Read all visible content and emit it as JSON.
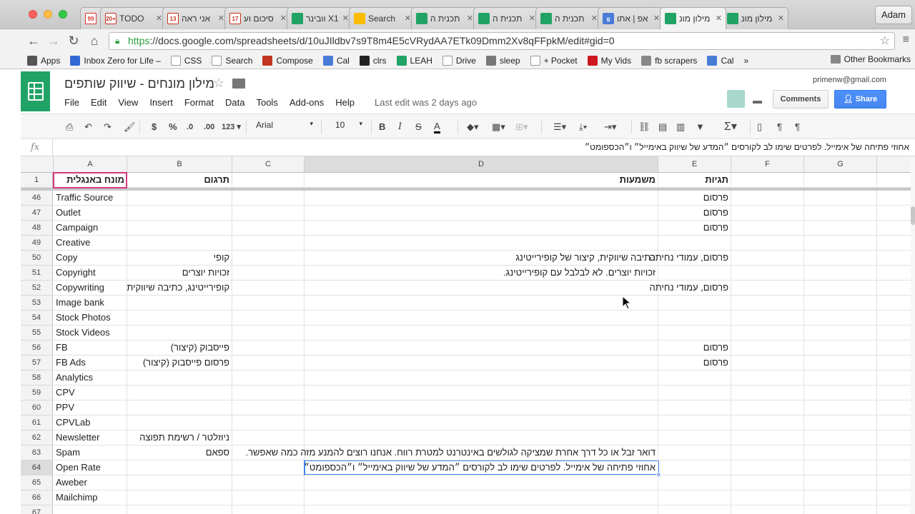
{
  "browser": {
    "tabs": [
      {
        "label": "",
        "fav": "num",
        "fav_text": "99",
        "active": false,
        "width": 34
      },
      {
        "label": "TODO",
        "fav": "gmail",
        "fav_text": "20+",
        "active": false
      },
      {
        "label": "אני ראה",
        "fav": "gmail",
        "fav_text": "13",
        "active": false
      },
      {
        "label": "סיכום וע",
        "fav": "gmail",
        "fav_text": "17",
        "active": false
      },
      {
        "label": "וובינר X1",
        "fav": "sheet",
        "fav_text": "",
        "active": false
      },
      {
        "label": "Search",
        "fav": "drive",
        "fav_text": "",
        "active": false
      },
      {
        "label": "תכנית ה",
        "fav": "sheet",
        "fav_text": "",
        "active": false
      },
      {
        "label": "תכנית ה",
        "fav": "sheet",
        "fav_text": "",
        "active": false
      },
      {
        "label": "תכנית ה",
        "fav": "sheet",
        "fav_text": "",
        "active": false
      },
      {
        "label": "אפ | אתו",
        "fav": "g",
        "fav_text": "g",
        "active": false
      },
      {
        "label": "מילון מונ",
        "fav": "sheet",
        "fav_text": "",
        "active": true
      },
      {
        "label": "מילון מונ",
        "fav": "sheet",
        "fav_text": "",
        "active": false
      }
    ],
    "profile_name": "Adam",
    "url_scheme": "https",
    "url_rest": "://docs.google.com/spreadsheets/d/10uJIldbv7s9T8m4E5cVRydAA7ETk09Dmm2Xv8qFFpkM/edit#gid=0",
    "bookmarks": [
      {
        "label": "Apps",
        "icon": "apps-icon",
        "color": "#555"
      },
      {
        "label": "Inbox Zero for Life –",
        "icon": "bookmark-icon",
        "color": "#3367d6"
      },
      {
        "label": "CSS",
        "icon": "page-icon",
        "color": "#fff"
      },
      {
        "label": "Search",
        "icon": "cursor-icon",
        "color": "#fff"
      },
      {
        "label": "Compose",
        "icon": "gmail-icon",
        "color": "#c23321"
      },
      {
        "label": "Cal",
        "icon": "calendar-icon",
        "color": "#4a7bd6"
      },
      {
        "label": "clrs",
        "icon": "heart-icon",
        "color": "#222"
      },
      {
        "label": "LEAH",
        "icon": "sheet-icon",
        "color": "#21a366"
      },
      {
        "label": "Drive",
        "icon": "page-icon",
        "color": "#fff"
      },
      {
        "label": "sleep",
        "icon": "zzz-icon",
        "color": "#777"
      },
      {
        "label": "+ Pocket",
        "icon": "page-icon",
        "color": "#fff"
      },
      {
        "label": "My Vids",
        "icon": "youtube-icon",
        "color": "#cc181e"
      },
      {
        "label": "fb scrapers",
        "icon": "folder-icon",
        "color": "#888"
      },
      {
        "label": "Cal",
        "icon": "calendar-icon",
        "color": "#4a7bd6"
      }
    ],
    "bookmarks_more": "»",
    "other_bookmarks": "Other Bookmarks"
  },
  "doc": {
    "title": "מילון מונחים - שיווק שותפים",
    "menus": [
      "File",
      "Edit",
      "View",
      "Insert",
      "Format",
      "Data",
      "Tools",
      "Add-ons",
      "Help"
    ],
    "last_edit": "Last edit was 2 days ago",
    "user_email": "primenw@gmail.com",
    "comments_label": "Comments",
    "share_label": "Share"
  },
  "toolbar": {
    "currency": "$",
    "percent": "%",
    "dec_less": ".0",
    "dec_more": ".00",
    "more_formats": "123",
    "font": "Arial",
    "font_size": "10",
    "bold": "B",
    "italic": "I",
    "strike": "S",
    "text_color": "A"
  },
  "formula_bar": {
    "fx": "fx",
    "content": "אחוזי פתיחה של אימייל. לפרטים שימו לב לקורסים ״המדע של שיווק באימייל״ ו״הכספומט״"
  },
  "columns": [
    {
      "id": "A",
      "selected": false
    },
    {
      "id": "B",
      "selected": false
    },
    {
      "id": "C",
      "selected": false
    },
    {
      "id": "D",
      "selected": true
    },
    {
      "id": "E",
      "selected": false
    },
    {
      "id": "F",
      "selected": false
    },
    {
      "id": "G",
      "selected": false
    }
  ],
  "header_row": {
    "num": "1",
    "a": "מונח באנגלית",
    "b": "תרגום",
    "c": "",
    "d": "משמעות",
    "e": "תגיות"
  },
  "rows": [
    {
      "num": "46",
      "a": "Traffic Source",
      "b": "",
      "d": "",
      "e": "פרסום"
    },
    {
      "num": "47",
      "a": "Outlet",
      "b": "",
      "d": "",
      "e": "פרסום"
    },
    {
      "num": "48",
      "a": "Campaign",
      "b": "",
      "d": "",
      "e": "פרסום"
    },
    {
      "num": "49",
      "a": "Creative",
      "b": "",
      "d": "",
      "e": ""
    },
    {
      "num": "50",
      "a": "Copy",
      "b": "קופי",
      "d": "כתיבה שיווקית, קיצור של קופירייטינג",
      "e": "פרסום, עמודי נחיתה"
    },
    {
      "num": "51",
      "a": "Copyright",
      "b": "זכויות יוצרים",
      "d": "זכויות יוצרים. לא לבלבל עם קופירייטינג.",
      "e": ""
    },
    {
      "num": "52",
      "a": "Copywriting",
      "b": "קופירייטינג, כתיבה שיווקית",
      "d": "",
      "e": "פרסום, עמודי נחיתה"
    },
    {
      "num": "53",
      "a": "Image bank",
      "b": "",
      "d": "",
      "e": ""
    },
    {
      "num": "54",
      "a": "Stock Photos",
      "b": "",
      "d": "",
      "e": ""
    },
    {
      "num": "55",
      "a": "Stock Videos",
      "b": "",
      "d": "",
      "e": ""
    },
    {
      "num": "56",
      "a": "FB",
      "b": "פייסבוק (קיצור)",
      "d": "",
      "e": "פרסום"
    },
    {
      "num": "57",
      "a": "FB Ads",
      "b": "פרסום פייסבוק (קיצור)",
      "d": "",
      "e": "פרסום"
    },
    {
      "num": "58",
      "a": "Analytics",
      "b": "",
      "d": "",
      "e": ""
    },
    {
      "num": "59",
      "a": "CPV",
      "b": "",
      "d": "",
      "e": ""
    },
    {
      "num": "60",
      "a": "PPV",
      "b": "",
      "d": "",
      "e": ""
    },
    {
      "num": "61",
      "a": "CPVLab",
      "b": "",
      "d": "",
      "e": ""
    },
    {
      "num": "62",
      "a": "Newsletter",
      "b": "ניוזלטר / רשימת תפוצה",
      "d": "",
      "e": ""
    },
    {
      "num": "63",
      "a": "Spam",
      "b": "ספאם",
      "d": "דואר זבל או כל דרך אחרת שמציקה לגולשים באינטרנט למטרת רווח. אנחנו רוצים להמנע מזה כמה שאפשר.",
      "e": ""
    },
    {
      "num": "64",
      "a": "Open Rate",
      "b": "",
      "d": "אחוזי פתיחה של אימייל. לפרטים שימו לב לקורסים ״המדע של שיווק באימייל״ ו״הכספומט״",
      "e": ""
    },
    {
      "num": "65",
      "a": "Aweber",
      "b": "",
      "d": "",
      "e": ""
    },
    {
      "num": "66",
      "a": "Mailchimp",
      "b": "",
      "d": "",
      "e": ""
    },
    {
      "num": "67",
      "a": "",
      "b": "",
      "d": "",
      "e": ""
    }
  ],
  "selected_row": "64"
}
